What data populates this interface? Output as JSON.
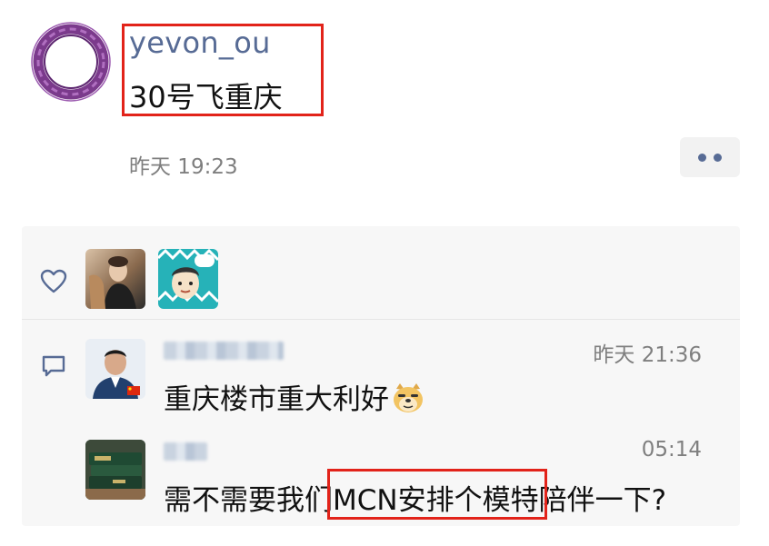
{
  "post": {
    "author": "yevon_ou",
    "text": "30号飞重庆",
    "time": "昨天 19:23",
    "more_icon": "more-dots-icon",
    "avatar_icon": "purple-ring-logo"
  },
  "likes": {
    "icon": "heart-icon",
    "likers": [
      {
        "name": "liker-1"
      },
      {
        "name": "liker-2"
      }
    ]
  },
  "comments": {
    "icon": "comment-icon",
    "items": [
      {
        "time": "昨天 21:36",
        "text": "重庆楼市重大利好",
        "emoji": "doge-emoji"
      },
      {
        "time": "05:14",
        "text": "需不需要我们MCN安排个模特陪伴一下?"
      }
    ]
  },
  "colors": {
    "link": "#576b95",
    "highlight_border": "#e2231a",
    "panel_bg": "#f7f7f7"
  }
}
